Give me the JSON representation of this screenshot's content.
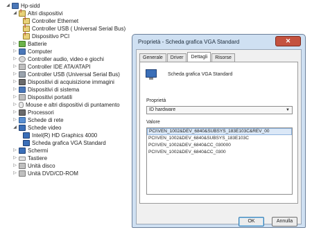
{
  "tree": {
    "root": "Hp-sidd",
    "items": [
      {
        "label": "Altri dispositivi",
        "icon": "unknown-devices-icon",
        "expander": "◢"
      },
      {
        "label": "Controller Ethernet",
        "icon": "warning-device-icon"
      },
      {
        "label": "Controller USB ( Universal Serial Bus)",
        "icon": "warning-device-icon"
      },
      {
        "label": "Dispositivo PCI",
        "icon": "warning-device-icon"
      },
      {
        "label": "Batterie",
        "icon": "battery-icon",
        "expander": "▷"
      },
      {
        "label": "Computer",
        "icon": "computer-icon",
        "expander": "▷"
      },
      {
        "label": "Controller audio, video e giochi",
        "icon": "audio-icon",
        "expander": "▷"
      },
      {
        "label": "Controller IDE ATA/ATAPI",
        "icon": "ide-controller-icon",
        "expander": "▷"
      },
      {
        "label": "Controller USB (Universal Serial Bus)",
        "icon": "usb-icon",
        "expander": "▷"
      },
      {
        "label": "Dispositivi di acquisizione immagini",
        "icon": "camera-icon",
        "expander": "▷"
      },
      {
        "label": "Dispositivi di sistema",
        "icon": "system-device-icon",
        "expander": "▷"
      },
      {
        "label": "Dispositivi portatili",
        "icon": "portable-device-icon",
        "expander": "▷"
      },
      {
        "label": "Mouse e altri dispositivi di puntamento",
        "icon": "mouse-icon",
        "expander": "▷"
      },
      {
        "label": "Processori",
        "icon": "processor-icon",
        "expander": "▷"
      },
      {
        "label": "Schede di rete",
        "icon": "network-icon",
        "expander": "▷"
      },
      {
        "label": "Schede video",
        "icon": "display-adapter-icon",
        "expander": "◢"
      },
      {
        "label": "Intel(R) HD Graphics 4000",
        "icon": "display-adapter-icon"
      },
      {
        "label": "Scheda grafica VGA Standard",
        "icon": "display-adapter-icon"
      },
      {
        "label": "Schermi",
        "icon": "monitor-icon",
        "expander": "▷"
      },
      {
        "label": "Tastiere",
        "icon": "keyboard-icon",
        "expander": "▷"
      },
      {
        "label": "Unità disco",
        "icon": "disk-drive-icon",
        "expander": "▷"
      },
      {
        "label": "Unità DVD/CD-ROM",
        "icon": "dvd-drive-icon",
        "expander": "▷"
      }
    ]
  },
  "dialog": {
    "title": "Proprietà - Scheda grafica VGA Standard",
    "close_label": "✕",
    "tabs": [
      {
        "label": "Generale"
      },
      {
        "label": "Driver"
      },
      {
        "label": "Dettagli"
      },
      {
        "label": "Risorse"
      }
    ],
    "active_tab": "Dettagli",
    "device_name": "Scheda grafica VGA Standard",
    "property_label": "Proprietà",
    "property_value": "ID hardware",
    "value_label": "Valore",
    "values": [
      "PCI\\VEN_1002&DEV_6840&SUBSYS_183E103C&REV_00",
      "PCI\\VEN_1002&DEV_6840&SUBSYS_183E103C",
      "PCI\\VEN_1002&DEV_6840&CC_030000",
      "PCI\\VEN_1002&DEV_6840&CC_0300"
    ],
    "ok_label": "OK",
    "cancel_label": "Annulla"
  }
}
